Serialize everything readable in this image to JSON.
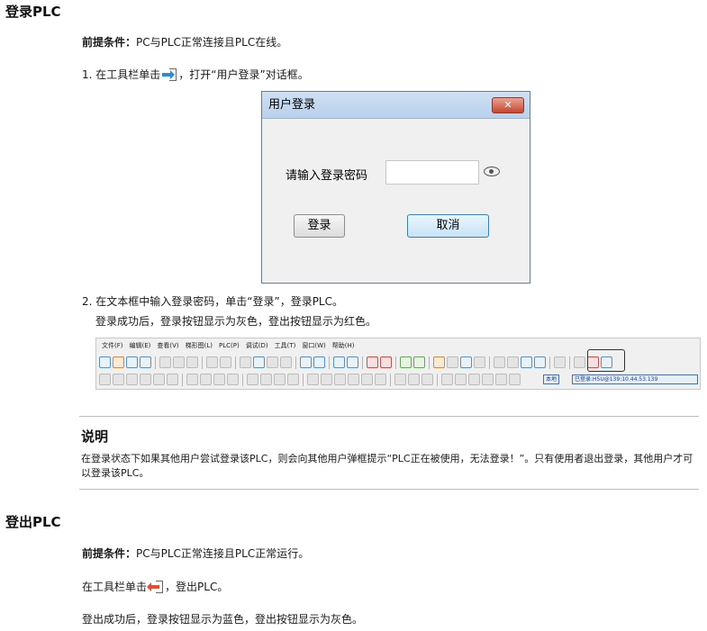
{
  "section1": {
    "title": "登录PLC",
    "prereq_label": "前提条件：",
    "prereq_text": "PC与PLC正常连接且PLC在线。",
    "step1_before": "1. 在工具栏单击",
    "step1_after": "，打开“用户登录”对话框。",
    "step2": "2. 在文本框中输入登录密码，单击“登录”，登录PLC。",
    "step2_result": "登录成功后，登录按钮显示为灰色，登出按钮显示为红色。"
  },
  "dialog": {
    "title": "用户登录",
    "close_glyph": "✕",
    "password_label": "请输入登录密码",
    "password_value": "",
    "login_button": "登录",
    "cancel_button": "取消"
  },
  "toolbar_screenshot": {
    "menu": [
      "文件(F)",
      "编辑(E)",
      "查看(V)",
      "梯形图(L)",
      "PLC(P)",
      "调试(D)",
      "工具(T)",
      "窗口(W)",
      "帮助(H)"
    ],
    "status_local": "本地",
    "status_login": "已登录:H5U@139:10.44.53.139"
  },
  "note": {
    "title": "说明",
    "text": "在登录状态下如果其他用户尝试登录该PLC，则会向其他用户弹框提示“PLC正在被使用，无法登录！”。只有使用者退出登录，其他用户才可以登录该PLC。"
  },
  "section2": {
    "title": "登出PLC",
    "prereq_label": "前提条件：",
    "prereq_text": "PC与PLC正常连接且PLC正常运行。",
    "step_before": "在工具栏单击",
    "step_after": "，登出PLC。",
    "result": "登出成功后，登录按钮显示为蓝色，登出按钮显示为灰色。"
  },
  "colors": {
    "login_icon": "#2a8ae0",
    "logout_icon": "#e84a2a"
  }
}
